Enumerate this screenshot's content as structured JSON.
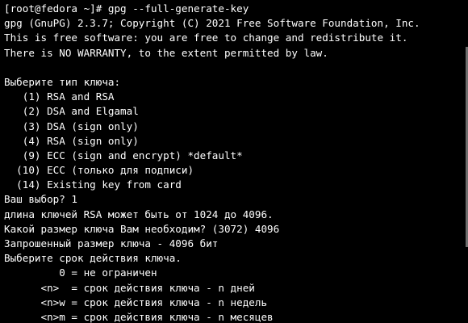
{
  "terminal": {
    "lines": [
      "[root@fedora ~]# gpg --full-generate-key",
      "gpg (GnuPG) 2.3.7; Copyright (C) 2021 Free Software Foundation, Inc.",
      "This is free software: you are free to change and redistribute it.",
      "There is NO WARRANTY, to the extent permitted by law.",
      "",
      "Выберите тип ключа:",
      "   (1) RSA and RSA",
      "   (2) DSA and Elgamal",
      "   (3) DSA (sign only)",
      "   (4) RSA (sign only)",
      "   (9) ECC (sign and encrypt) *default*",
      "  (10) ECC (только для подписи)",
      "  (14) Existing key from card",
      "Ваш выбор? 1",
      "длина ключей RSA может быть от 1024 до 4096.",
      "Какой размер ключа Вам необходим? (3072) 4096",
      "Запрошенный размер ключа - 4096 бит",
      "Выберите срок действия ключа.",
      "         0 = не ограничен",
      "      <n>  = срок действия ключа - n дней",
      "      <n>w = срок действия ключа - n недель",
      "      <n>m = срок действия ключа - n месяцев"
    ]
  },
  "scroll": {
    "visible_fraction": 0.62,
    "position_fraction": 0.38
  },
  "colors": {
    "background": "#000000",
    "foreground": "#ffffff",
    "scrollbar_thumb": "#6e6e6e"
  }
}
